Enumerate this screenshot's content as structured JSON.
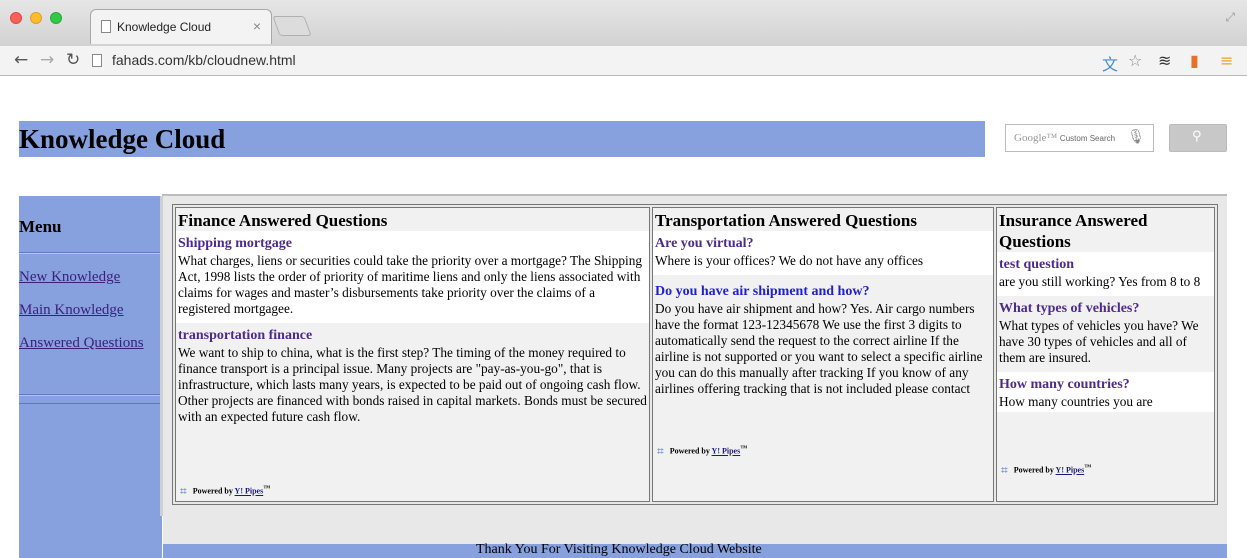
{
  "browser": {
    "tab_title": "Knowledge Cloud",
    "tab_close": "×",
    "url": "fahads.com/kb/cloudnew.html",
    "icons": [
      "back-icon",
      "forward-icon",
      "reload-icon",
      "page-icon",
      "translate-icon",
      "star-icon",
      "layers-icon",
      "bookmark-icon",
      "menu-icon"
    ]
  },
  "header": {
    "title": "Knowledge Cloud",
    "search_brand": "Google",
    "search_brand_suffix": "Custom Search"
  },
  "sidebar": {
    "heading": "Menu",
    "links": [
      "New Knowledge",
      "Main Knowledge",
      "Answered Questions"
    ]
  },
  "columns": [
    {
      "title": "Finance Answered Questions",
      "items": [
        {
          "title": "Shipping mortgage",
          "body": "What charges, liens or securities could take the priority over a mortgage? The Shipping Act, 1998 lists the order of priority of maritime liens and only the liens associated with claims for wages and master’s disbursements take priority over the claims of a registered mortgagee."
        },
        {
          "title": "transportation finance",
          "body": "We want to ship to china, what is the first step? The timing of the money required to finance transport is a principal issue. Many projects are \"pay-as-you-go\", that is infrastructure, which lasts many years, is expected to be paid out of ongoing cash flow. Other projects are financed with bonds raised in capital markets. Bonds must be secured with an expected future cash flow."
        }
      ]
    },
    {
      "title": "Transportation Answered Questions",
      "items": [
        {
          "title": "Are you virtual?",
          "body": "Where is your offices?   We do not have any offices"
        },
        {
          "title": "Do you have air shipment and how?",
          "body": "Do you have air shipment and how?   Yes. Air cargo numbers have the format 123-12345678   We use the first 3 digits to automatically send the request to the correct airline If the airline is not supported or you want to select a specific airline you can do this manually after tracking If you know of any airlines offering tracking that is not included please contact"
        }
      ]
    },
    {
      "title": "Insurance Answered Questions",
      "items": [
        {
          "title": "test question",
          "body": "are you still working?   Yes from 8 to 8"
        },
        {
          "title": "What types of vehicles?",
          "body": "What types of vehicles you have? We have 30 types of vehicles and all of them are insured."
        },
        {
          "title": "How many countries?",
          "body": "How many countries you are"
        }
      ]
    }
  ],
  "powered": {
    "prefix": "Powered by",
    "link": "Y! Pipes",
    "tm": "™"
  },
  "footer": {
    "text": "Thank You For Visiting Knowledge Cloud Website"
  }
}
